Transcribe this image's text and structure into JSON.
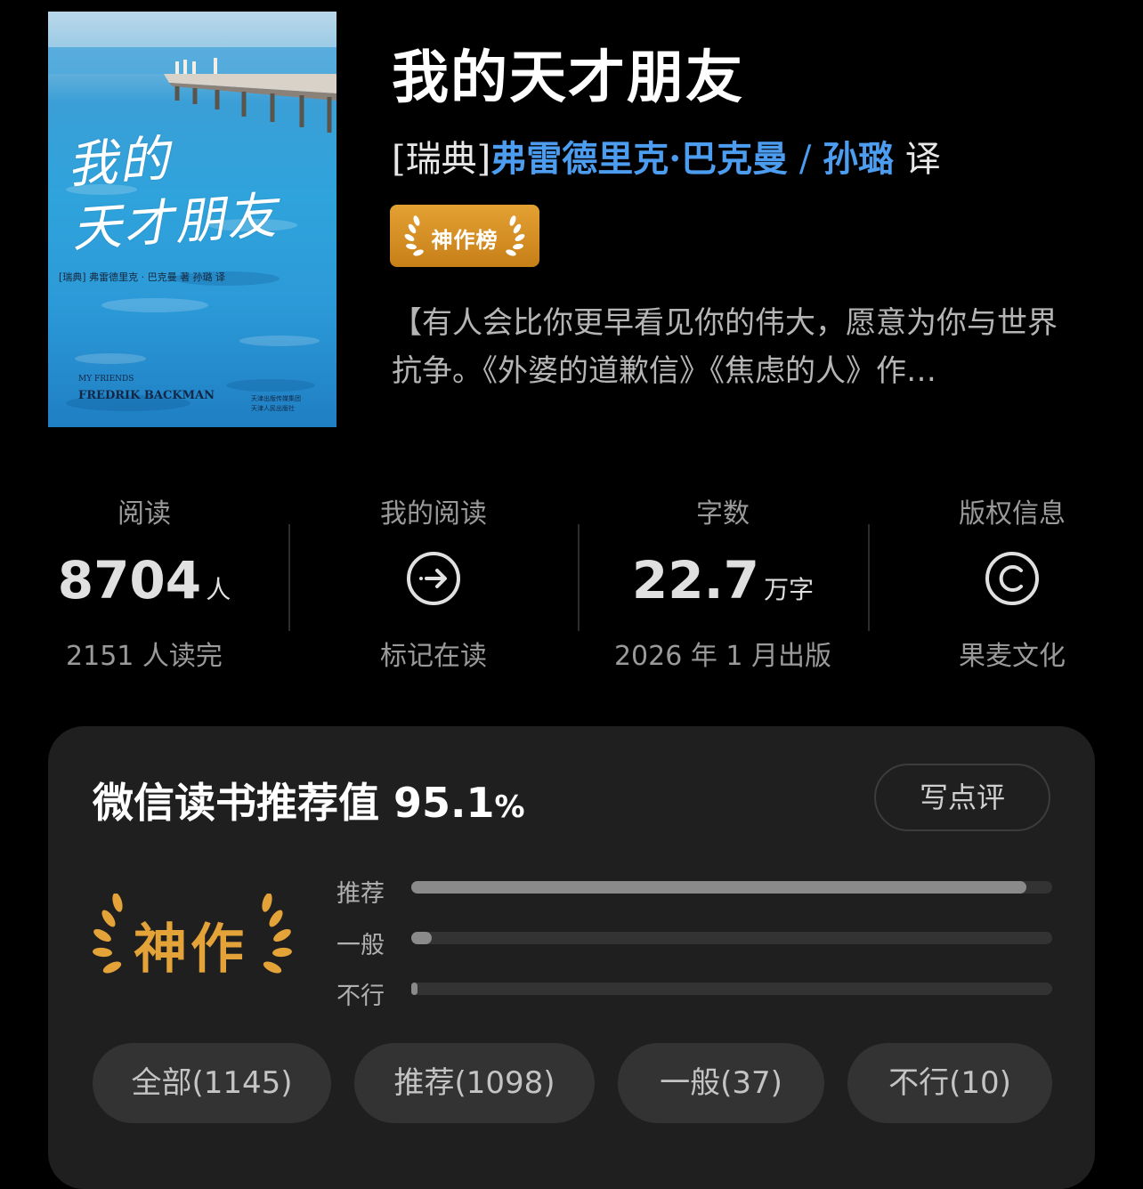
{
  "book": {
    "title": "我的天才朋友",
    "author_prefix": "[瑞典]",
    "author": "弗雷德里克·巴克曼",
    "separator": "/",
    "translator": "孙璐",
    "translator_suffix": "译",
    "badge": "神作榜",
    "description": "【有人会比你更早看见你的伟大，愿意为你与世界抗争。《外婆的道歉信》《焦虑的人》作…"
  },
  "cover": {
    "title_line1": "我的",
    "title_line2": "天才朋友",
    "byline": "[瑞典]  弗雷德里克 · 巴克曼  著        孙璐  译",
    "en_sub": "MY FRIENDS",
    "en_author": "FREDRIK BACKMAN",
    "publisher1": "天津出版传媒集团",
    "publisher2": "天津人民出版社"
  },
  "stats": {
    "read": {
      "label": "阅读",
      "value": "8704",
      "unit": "人",
      "sub": "2151 人读完"
    },
    "my_read": {
      "label": "我的阅读",
      "icon": "arrow-circle-icon",
      "sub": "标记在读"
    },
    "words": {
      "label": "字数",
      "value": "22.7",
      "unit": "万字",
      "sub": "2026 年 1 月出版"
    },
    "copyright": {
      "label": "版权信息",
      "icon": "copyright-icon",
      "sub": "果麦文化"
    }
  },
  "rating": {
    "title": "微信读书推荐值",
    "value": "95.1",
    "pct_sign": "%",
    "write_button": "写点评",
    "grade": "神作",
    "bars": [
      {
        "label": "推荐",
        "fraction": 0.96
      },
      {
        "label": "一般",
        "fraction": 0.032
      },
      {
        "label": "不行",
        "fraction": 0.009
      }
    ],
    "filters": [
      "全部(1145)",
      "推荐(1098)",
      "一般(37)",
      "不行(10)"
    ]
  },
  "colors": {
    "link": "#4c9cf0",
    "gold": "#e3a338",
    "background": "#000000",
    "card": "#1f1f1f"
  }
}
